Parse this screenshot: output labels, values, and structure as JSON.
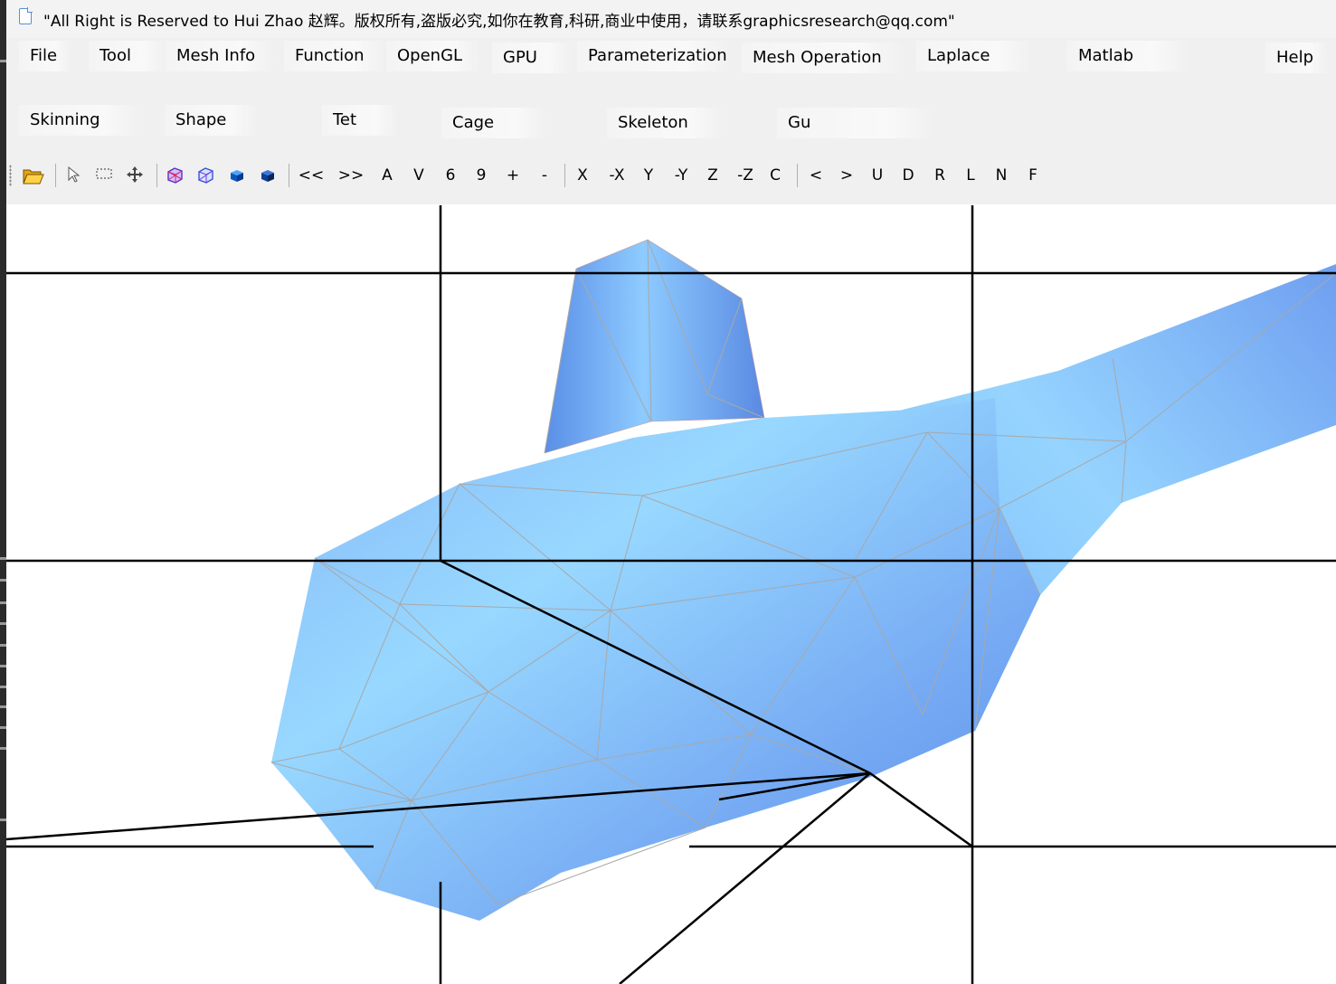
{
  "window": {
    "title": "\"All Right is Reserved to Hui Zhao 赵辉。版权所有,盗版必究,如你在教育,科研,商业中使用，请联系graphicsresearch@qq.com\""
  },
  "menubar": {
    "row1": [
      "File",
      "Tool",
      "Mesh Info",
      "Function",
      "OpenGL",
      "GPU",
      "Parameterization",
      "Mesh Operation",
      "Laplace",
      "Matlab",
      "Help"
    ],
    "row2": [
      "Skinning",
      "Shape",
      "Tet",
      "Cage",
      "Skeleton",
      "Gu"
    ]
  },
  "toolbar": {
    "icons": [
      "open-folder-icon",
      "select-pointer-icon",
      "rect-select-icon",
      "move-icon",
      "wireframe-cube-icon",
      "wireframe-cube-alt-icon",
      "solid-cube-icon",
      "solid-cube-dark-icon"
    ],
    "buttons_a": [
      "<<",
      ">>",
      "A",
      "V",
      "6",
      "9",
      "+",
      "-"
    ],
    "buttons_b": [
      "X",
      "-X",
      "Y",
      "-Y",
      "Z",
      "-Z",
      "C"
    ],
    "buttons_c": [
      "<",
      ">",
      "U",
      "D",
      "R",
      "L",
      "N",
      "F"
    ]
  },
  "viewport": {
    "mesh_color": "#7aaef5",
    "mesh_highlight": "#98d6ff",
    "wire_color": "#a9a9a9",
    "line_color": "#000000"
  }
}
